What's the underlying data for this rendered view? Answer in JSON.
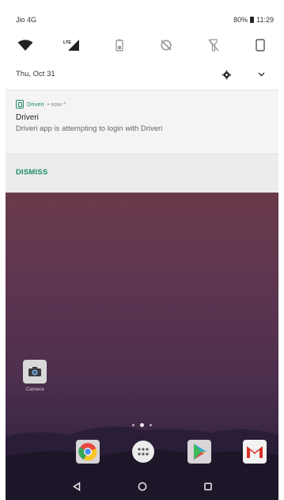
{
  "status_bar": {
    "carrier": "Jio 4G",
    "battery": "80%",
    "time": "11:29",
    "network_badge": "LTE"
  },
  "quick_settings": {
    "tiles": [
      "wifi-icon",
      "mobile-data-icon",
      "battery-saver-icon",
      "data-saver-icon",
      "flashlight-icon",
      "auto-rotate-icon"
    ],
    "date": "Thu, Oct 31"
  },
  "notification": {
    "app_name": "Driveri",
    "time": "• now ^",
    "title": "Driveri",
    "body": "Driveri app is attempting to login with Driveri",
    "action_label": "DISMISS",
    "accent_color": "#1f8a6a"
  },
  "home": {
    "camera_label": "Camera",
    "dock_apps": [
      "chrome-icon",
      "app-drawer-icon",
      "play-store-icon",
      "gmail-icon"
    ],
    "page_indicator": {
      "pages": 3,
      "active": 2
    }
  },
  "nav": [
    "back-icon",
    "home-icon",
    "recents-icon"
  ]
}
